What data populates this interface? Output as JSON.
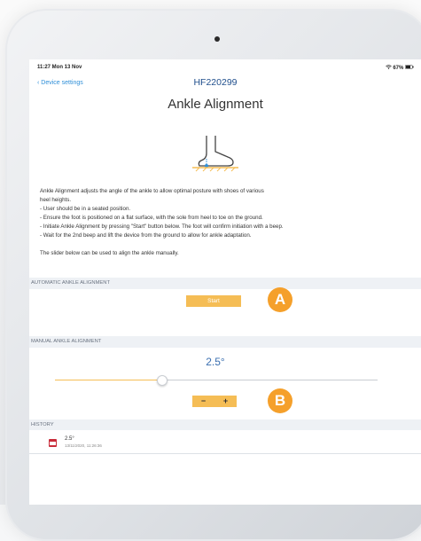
{
  "status": {
    "time": "11:27  Mon 13 Nov",
    "battery": "67%"
  },
  "nav": {
    "back_label": "Device settings",
    "device_id": "HF220299"
  },
  "page": {
    "title": "Ankle Alignment"
  },
  "description": [
    "Ankle Alignment adjusts the angle of the ankle to allow optimal posture with shoes of various",
    "heel heights.",
    "- User should be in a seated position.",
    "- Ensure the foot is positioned on a flat surface, with the sole from heel to toe on the ground.",
    "- Initiate Ankle Alignment by pressing \"Start\" button below. The foot will confirm initiation with a beep.",
    "- Wait for the 2nd beep and lift the device from the ground to allow for ankle adaptation.",
    "",
    "The slider below can be used to align the ankle manually."
  ],
  "automatic": {
    "header": "AUTOMATIC ANKLE ALIGNMENT",
    "start_label": "Start"
  },
  "manual": {
    "header": "MANUAL ANKLE ALIGNMENT",
    "value": "2.5°",
    "slider_fraction": 0.33,
    "minus_label": "−",
    "plus_label": "+"
  },
  "history": {
    "header": "HISTORY",
    "entries": [
      {
        "value": "2.5°",
        "date": "13/11/2020, 11:26:36"
      }
    ]
  },
  "markers": {
    "a": "A",
    "b": "B"
  },
  "colors": {
    "accent": "#f5bd55",
    "marker": "#f5a02b",
    "link": "#2f8fd8",
    "calendar": "#c92c3a"
  }
}
